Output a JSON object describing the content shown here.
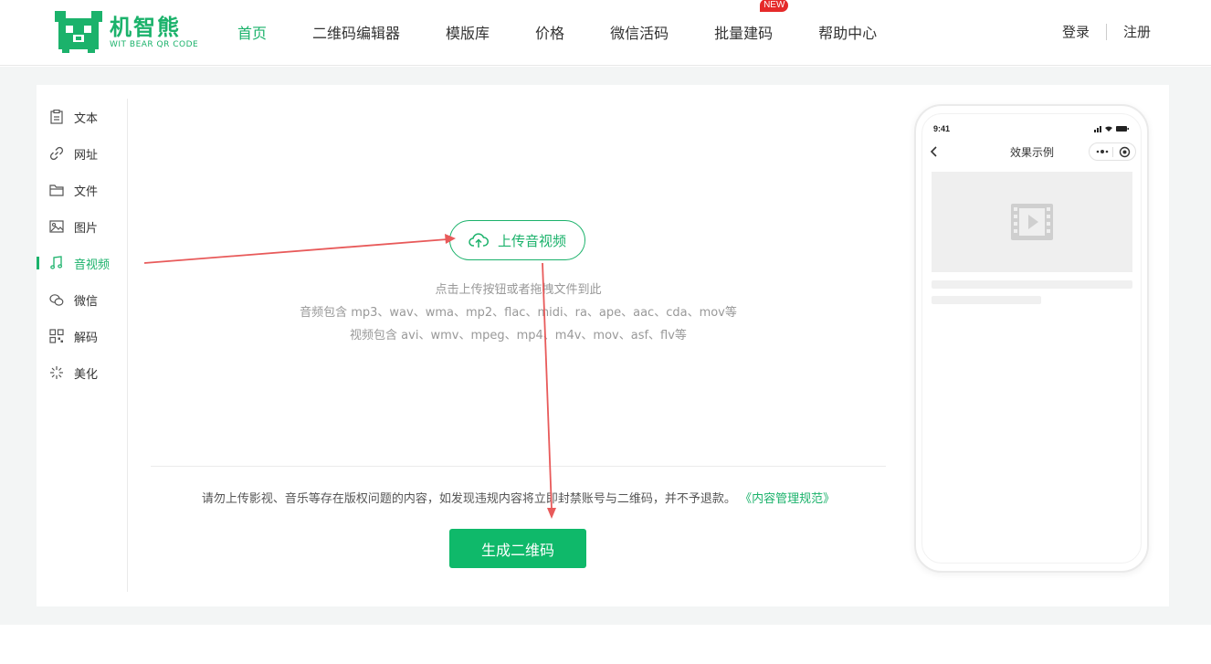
{
  "logo": {
    "name_cn": "机智熊",
    "name_en": "WIT BEAR QR CODE"
  },
  "nav": {
    "items": [
      {
        "label": "首页",
        "active": true
      },
      {
        "label": "二维码编辑器"
      },
      {
        "label": "模版库"
      },
      {
        "label": "价格"
      },
      {
        "label": "微信活码"
      },
      {
        "label": "批量建码",
        "badge": "NEW"
      },
      {
        "label": "帮助中心"
      }
    ]
  },
  "auth": {
    "login": "登录",
    "register": "注册"
  },
  "sidebar": {
    "items": [
      {
        "label": "文本",
        "icon": "text-doc-icon"
      },
      {
        "label": "网址",
        "icon": "link-icon"
      },
      {
        "label": "文件",
        "icon": "folder-icon"
      },
      {
        "label": "图片",
        "icon": "image-icon"
      },
      {
        "label": "音视频",
        "icon": "music-note-icon",
        "active": true
      },
      {
        "label": "微信",
        "icon": "wechat-icon"
      },
      {
        "label": "解码",
        "icon": "qr-grid-icon"
      },
      {
        "label": "美化",
        "icon": "sparkle-icon"
      }
    ]
  },
  "upload": {
    "button_label": "上传音视频",
    "hint_line1": "点击上传按钮或者拖拽文件到此",
    "hint_line2": "音频包含 mp3、wav、wma、mp2、flac、midi、ra、ape、aac、cda、mov等",
    "hint_line3": "视频包含 avi、wmv、mpeg、mp4、m4v、mov、asf、flv等"
  },
  "notice": {
    "text": "请勿上传影视、音乐等存在版权问题的内容，如发现违规内容将立即封禁账号与二维码，并不予退款。",
    "link": "《内容管理规范》"
  },
  "generate_button": "生成二维码",
  "phone": {
    "time": "9:41",
    "title": "效果示例"
  },
  "colors": {
    "brand": "#1bb26b",
    "button": "#0fb96a",
    "badge": "#e52a2a",
    "annotation": "#e85a5a"
  }
}
